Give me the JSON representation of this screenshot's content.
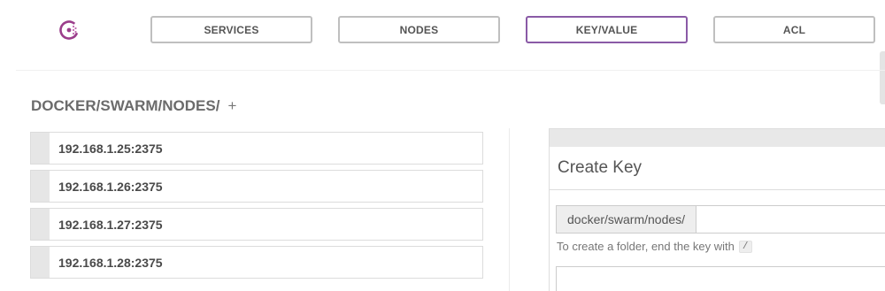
{
  "nav": {
    "logo_icon": "consul-logo-icon",
    "items": [
      {
        "label": "SERVICES",
        "active": false
      },
      {
        "label": "NODES",
        "active": false
      },
      {
        "label": "KEY/VALUE",
        "active": true
      },
      {
        "label": "ACL",
        "active": false
      }
    ]
  },
  "colors": {
    "accent": "#8a5aa6",
    "logo": "#9b3e8b",
    "border": "#bfbfbf"
  },
  "breadcrumb": {
    "path": "DOCKER/SWARM/NODES/",
    "add_icon": "+"
  },
  "keys": [
    {
      "label": "192.168.1.25:2375"
    },
    {
      "label": "192.168.1.26:2375"
    },
    {
      "label": "192.168.1.27:2375"
    },
    {
      "label": "192.168.1.28:2375"
    }
  ],
  "create_key": {
    "title": "Create Key",
    "prefix": "docker/swarm/nodes/",
    "key_value": "",
    "hint_text": "To create a folder, end the key with",
    "hint_code": "/"
  }
}
